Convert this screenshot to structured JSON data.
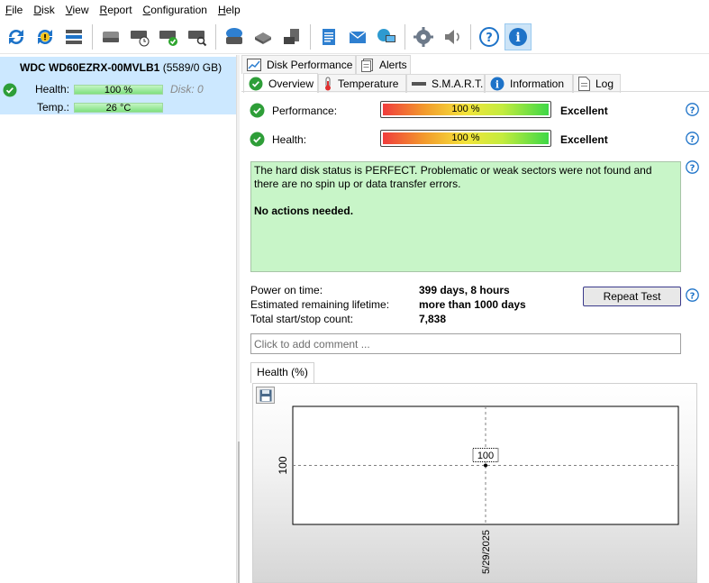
{
  "menu": [
    {
      "hotkey": "F",
      "rest": "ile"
    },
    {
      "hotkey": "D",
      "rest": "isk"
    },
    {
      "hotkey": "V",
      "rest": "iew"
    },
    {
      "hotkey": "R",
      "rest": "eport"
    },
    {
      "hotkey": "C",
      "rest": "onfiguration"
    },
    {
      "hotkey": "H",
      "rest": "elp"
    }
  ],
  "toolbar": {
    "icons": [
      "refresh-icon",
      "refresh-warning-icon",
      "disk-list-icon",
      "disk-icon",
      "disk-schedule-icon",
      "disk-check-icon",
      "disk-search-icon",
      "disk-backup-icon",
      "usb-disk-icon",
      "network-disk-icon",
      "notepad-icon",
      "email-icon",
      "remote-monitor-icon",
      "settings-gear-icon",
      "speaker-icon",
      "help-icon",
      "info-icon"
    ]
  },
  "disk": {
    "model": "WDC WD60EZRX-00MVLB1",
    "capacity": "(5589/0 GB)",
    "health_label": "Health:",
    "health_value": "100 %",
    "disk_label": "Disk: 0",
    "temp_label": "Temp.:",
    "temp_value": "26 °C"
  },
  "tabs_top": [
    "Disk Performance",
    "Alerts"
  ],
  "tabs_bottom": [
    "Overview",
    "Temperature",
    "S.M.A.R.T.",
    "Information",
    "Log"
  ],
  "overview": {
    "performance_label": "Performance:",
    "performance_value": "100 %",
    "performance_fraction": 1.0,
    "performance_rating": "Excellent",
    "health_label": "Health:",
    "health_value": "100 %",
    "health_fraction": 1.0,
    "health_rating": "Excellent",
    "status_text": "The hard disk status is PERFECT. Problematic or weak sectors were not found and there are no spin up or data transfer errors.",
    "action_text": "No actions needed.",
    "power_on_label": "Power on time:",
    "power_on_value": "399 days, 8 hours",
    "lifetime_label": "Estimated remaining lifetime:",
    "lifetime_value": "more than 1000 days",
    "startstop_label": "Total start/stop count:",
    "startstop_value": "7,838",
    "repeat_button": "Repeat Test",
    "comment_placeholder": "Click to add comment ..."
  },
  "chart_tab": "Health (%)",
  "chart_data": {
    "type": "line",
    "x": [
      "5/29/2025"
    ],
    "series": [
      {
        "values": [
          100
        ]
      }
    ],
    "point_labels": [
      "100"
    ],
    "y_tick_labels": [
      "100"
    ],
    "x_tick_labels": [
      "5/29/2025"
    ],
    "xlabel": "",
    "ylabel": "",
    "grid": true,
    "colors": {
      "point": "#000000",
      "grid": "#808080"
    }
  }
}
